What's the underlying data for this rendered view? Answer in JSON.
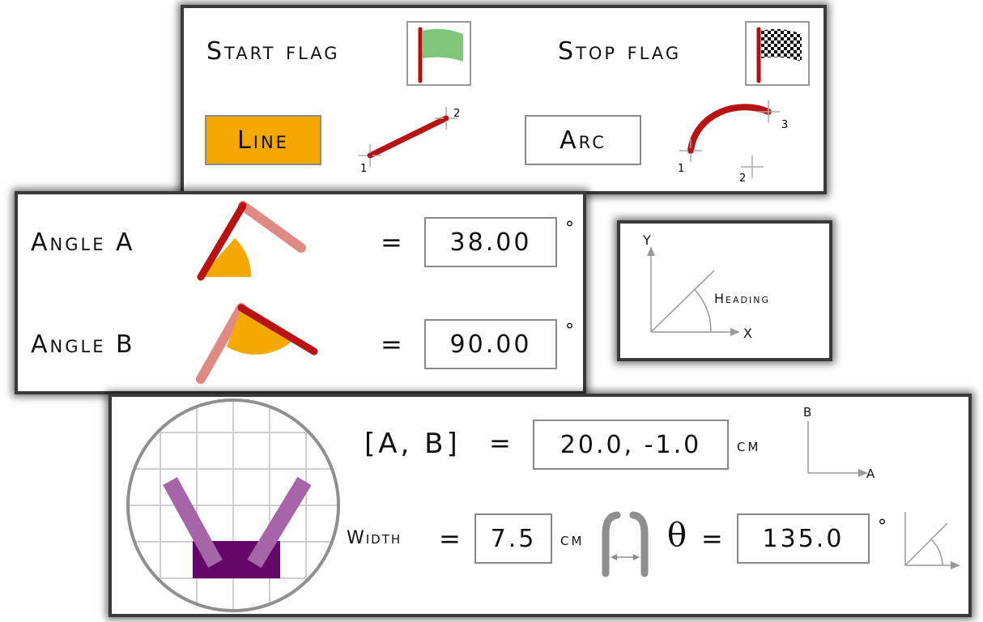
{
  "flags": {
    "start_label": "Start flag",
    "stop_label": "Stop flag"
  },
  "path_tools": {
    "line_label": "Line",
    "arc_label": "Arc",
    "line_points": [
      "1",
      "2"
    ],
    "arc_points": [
      "1",
      "2",
      "3"
    ],
    "active_color": "#f5a800"
  },
  "angles": {
    "a_label": "Angle A",
    "a_equals": "=",
    "a_value": "38.00",
    "a_unit": "°",
    "b_label": "Angle B",
    "b_equals": "=",
    "b_value": "90.00",
    "b_unit": "°"
  },
  "heading_panel": {
    "y_label": "Y",
    "x_label": "X",
    "heading_label": "Heading"
  },
  "gripper": {
    "ab_label": "[A, B]",
    "ab_equals": "=",
    "ab_value": "20.0, -1.0",
    "ab_unit": "cm",
    "axis_b": "B",
    "axis_a": "A",
    "width_label": "Width",
    "width_equals": "=",
    "width_value": "7.5",
    "width_unit": "cm",
    "theta_label": "θ",
    "theta_equals": "=",
    "theta_value": "135.0",
    "theta_unit": "°",
    "colors": {
      "arm": "#a565a8",
      "base": "#630866",
      "grid": "#cfcfcf"
    }
  }
}
